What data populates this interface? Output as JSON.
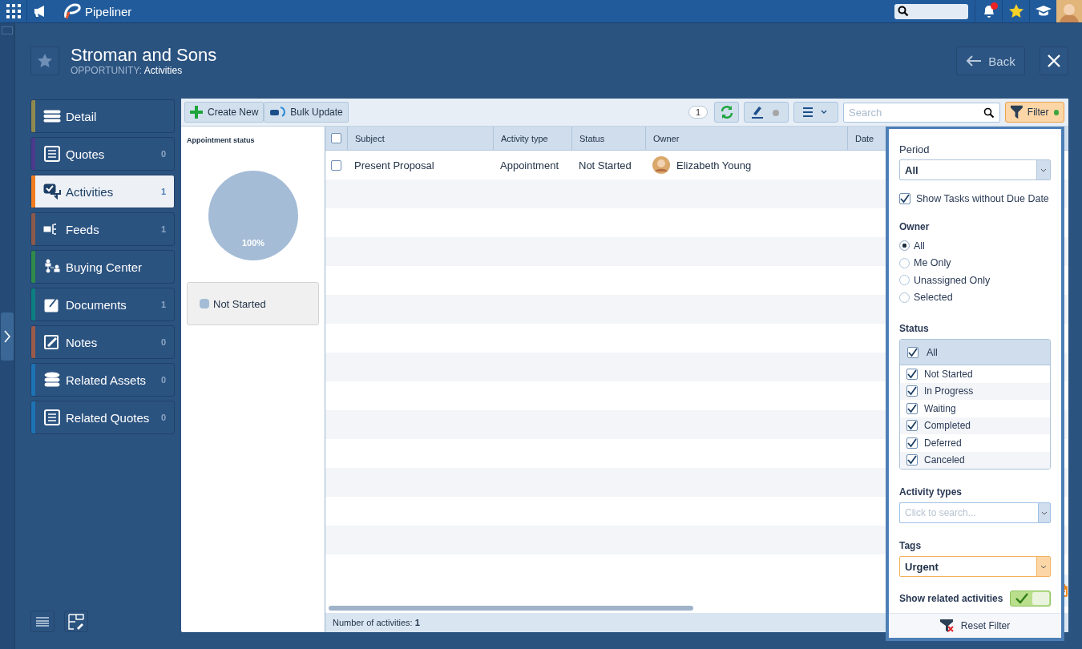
{
  "top_bar": {
    "logo": "Pipeliner",
    "notifications_unread": true
  },
  "header": {
    "title": "Stroman and Sons",
    "entity": "OPPORTUNITY:",
    "section": "Activities",
    "back": "Back"
  },
  "nav": [
    {
      "label": "Detail",
      "color": "#8f8a4f",
      "selected": false
    },
    {
      "label": "Quotes",
      "count": "0",
      "color": "#4b3a8c",
      "selected": false
    },
    {
      "label": "Activities",
      "count": "1",
      "color": "#f07c1f",
      "selected": true
    },
    {
      "label": "Feeds",
      "count": "1",
      "color": "#8b5a4a",
      "selected": false
    },
    {
      "label": "Buying Center",
      "color": "#2e8b4a",
      "selected": false
    },
    {
      "label": "Documents",
      "count": "1",
      "color": "#0e7f80",
      "selected": false
    },
    {
      "label": "Notes",
      "count": "0",
      "color": "#9b5a4a",
      "selected": false
    },
    {
      "label": "Related Assets",
      "count": "0",
      "color": "#1e73b5",
      "selected": false
    },
    {
      "label": "Related Quotes",
      "count": "0",
      "color": "#1e73b5",
      "selected": false
    }
  ],
  "toolbar": {
    "create_new": "Create New",
    "bulk_update": "Bulk Update",
    "count": "1",
    "search_placeholder": "Search",
    "filter": "Filter",
    "filter_active": true
  },
  "chart_panel": {
    "title": "Appointment status",
    "slice_label": "100%",
    "legend": [
      "Not Started"
    ]
  },
  "table": {
    "all_checked": false,
    "columns": [
      "Subject",
      "Activity type",
      "Status",
      "Owner",
      "Date"
    ],
    "rows": [
      {
        "checked": false,
        "subject": "Present Proposal",
        "activity_type": "Appointment",
        "status": "Not Started",
        "owner": "Elizabeth Young"
      }
    ],
    "footer_label": "Number of activities:",
    "footer_count": "1"
  },
  "filter": {
    "period": {
      "label": "Period",
      "value": "All"
    },
    "show_tasks": {
      "label": "Show Tasks without Due Date",
      "checked": true
    },
    "owner": {
      "label": "Owner",
      "options": [
        {
          "label": "All",
          "selected": true
        },
        {
          "label": "Me Only",
          "selected": false
        },
        {
          "label": "Unassigned Only",
          "selected": false
        },
        {
          "label": "Selected",
          "selected": false
        }
      ]
    },
    "status": {
      "label": "Status",
      "all": {
        "label": "All",
        "checked": true
      },
      "options": [
        {
          "label": "Not Started",
          "checked": true
        },
        {
          "label": "In Progress",
          "checked": true
        },
        {
          "label": "Waiting",
          "checked": true
        },
        {
          "label": "Completed",
          "checked": true
        },
        {
          "label": "Deferred",
          "checked": true
        },
        {
          "label": "Canceled",
          "checked": true
        }
      ]
    },
    "activity_types": {
      "label": "Activity types",
      "placeholder": "Click to search..."
    },
    "tags": {
      "label": "Tags",
      "value": "Urgent"
    },
    "show_related": {
      "label": "Show related activities",
      "on": true
    },
    "reset": "Reset Filter"
  }
}
